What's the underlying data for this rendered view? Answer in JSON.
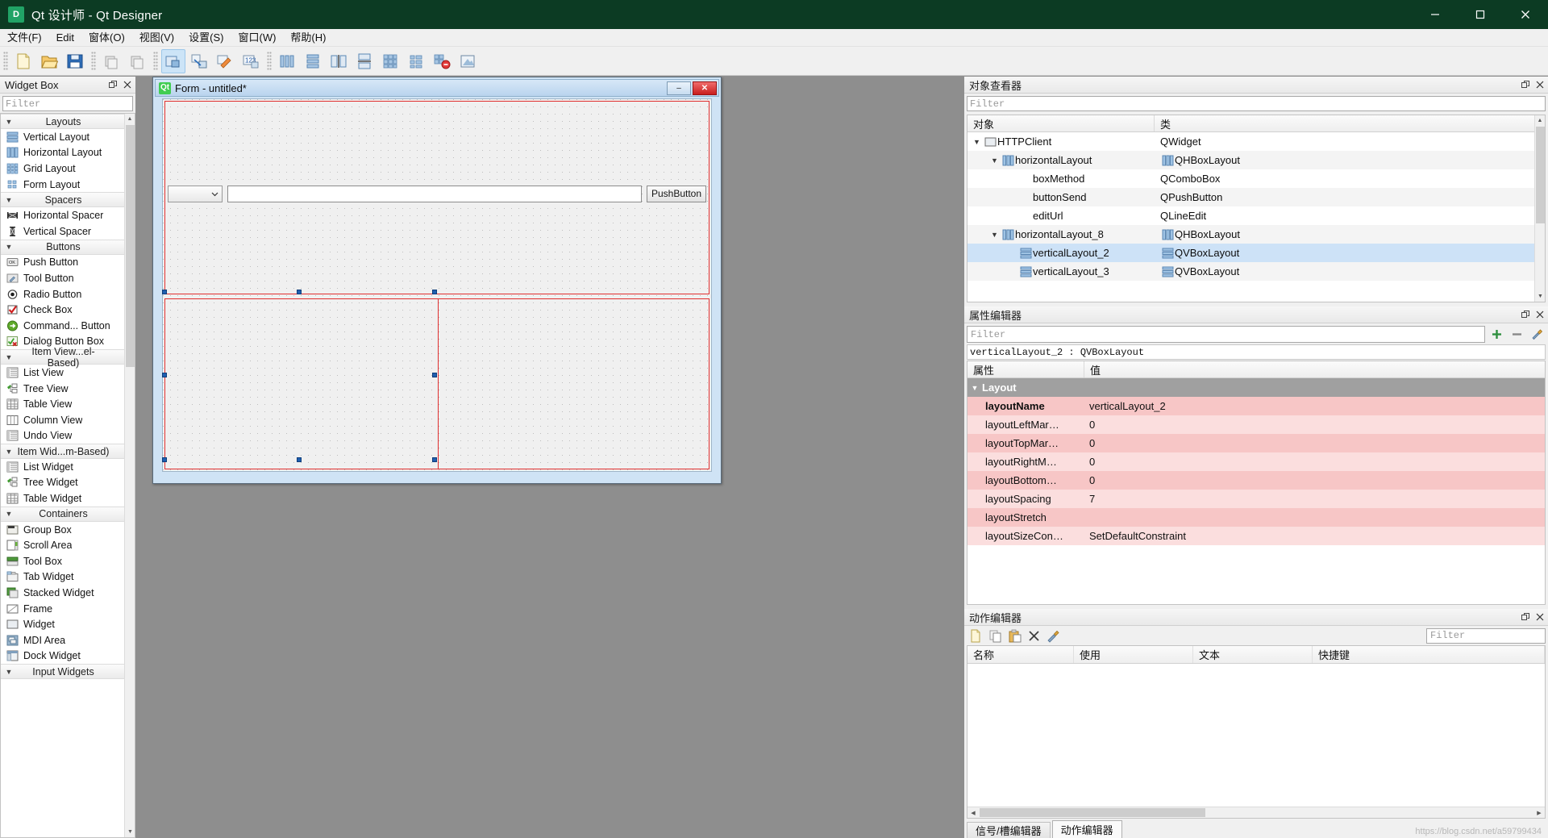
{
  "window": {
    "title": "Qt 设计师 - Qt Designer",
    "app_icon": "D",
    "minimize_label": "minimize",
    "maximize_label": "maximize",
    "close_label": "close"
  },
  "menubar": {
    "items": [
      {
        "label": "文件(F)"
      },
      {
        "label": "Edit"
      },
      {
        "label": "窗体(O)"
      },
      {
        "label": "视图(V)"
      },
      {
        "label": "设置(S)"
      },
      {
        "label": "窗口(W)"
      },
      {
        "label": "帮助(H)"
      }
    ]
  },
  "toolbar": {
    "groups": [
      [
        "new-file-icon",
        "open-file-icon",
        "save-file-icon"
      ],
      [
        "undo-icon",
        "redo-icon"
      ],
      [
        "edit-widgets-icon",
        "edit-signals-icon",
        "edit-buddies-icon",
        "edit-tab-order-icon"
      ],
      [
        "layout-horizontal-icon",
        "layout-vertical-icon",
        "layout-splitter-h-icon",
        "layout-splitter-v-icon",
        "layout-grid-icon",
        "layout-form-icon",
        "break-layout-icon",
        "adjust-size-icon"
      ]
    ]
  },
  "widget_box": {
    "title": "Widget Box",
    "filter_placeholder": "Filter",
    "float_button": "float-icon",
    "close_button": "close-icon",
    "categories": [
      {
        "name": "Layouts",
        "items": [
          {
            "label": "Vertical Layout",
            "icon": "vertical-layout-icon"
          },
          {
            "label": "Horizontal Layout",
            "icon": "horizontal-layout-icon"
          },
          {
            "label": "Grid Layout",
            "icon": "grid-layout-icon"
          },
          {
            "label": "Form Layout",
            "icon": "form-layout-icon"
          }
        ]
      },
      {
        "name": "Spacers",
        "items": [
          {
            "label": "Horizontal Spacer",
            "icon": "horizontal-spacer-icon"
          },
          {
            "label": "Vertical Spacer",
            "icon": "vertical-spacer-icon"
          }
        ]
      },
      {
        "name": "Buttons",
        "items": [
          {
            "label": "Push Button",
            "icon": "push-button-icon"
          },
          {
            "label": "Tool Button",
            "icon": "tool-button-icon"
          },
          {
            "label": "Radio Button",
            "icon": "radio-button-icon"
          },
          {
            "label": "Check Box",
            "icon": "check-box-icon"
          },
          {
            "label": "Command... Button",
            "icon": "command-link-button-icon"
          },
          {
            "label": "Dialog Button Box",
            "icon": "dialog-button-box-icon"
          }
        ]
      },
      {
        "name": "Item View...el-Based)",
        "items": [
          {
            "label": "List View",
            "icon": "list-view-icon"
          },
          {
            "label": "Tree View",
            "icon": "tree-view-icon"
          },
          {
            "label": "Table View",
            "icon": "table-view-icon"
          },
          {
            "label": "Column View",
            "icon": "column-view-icon"
          },
          {
            "label": "Undo View",
            "icon": "undo-view-icon"
          }
        ]
      },
      {
        "name": "Item Wid...m-Based)",
        "items": [
          {
            "label": "List Widget",
            "icon": "list-widget-icon"
          },
          {
            "label": "Tree Widget",
            "icon": "tree-widget-icon"
          },
          {
            "label": "Table Widget",
            "icon": "table-widget-icon"
          }
        ]
      },
      {
        "name": "Containers",
        "items": [
          {
            "label": "Group Box",
            "icon": "group-box-icon"
          },
          {
            "label": "Scroll Area",
            "icon": "scroll-area-icon"
          },
          {
            "label": "Tool Box",
            "icon": "tool-box-icon"
          },
          {
            "label": "Tab Widget",
            "icon": "tab-widget-icon"
          },
          {
            "label": "Stacked Widget",
            "icon": "stacked-widget-icon"
          },
          {
            "label": "Frame",
            "icon": "frame-icon"
          },
          {
            "label": "Widget",
            "icon": "widget-icon"
          },
          {
            "label": "MDI Area",
            "icon": "mdi-area-icon"
          },
          {
            "label": "Dock Widget",
            "icon": "dock-widget-icon"
          }
        ]
      },
      {
        "name": "Input Widgets",
        "items": []
      }
    ]
  },
  "form": {
    "title": "Form - untitled*",
    "logo": "Qt",
    "minimize_label": "–",
    "close_label": "✕",
    "combo_value": "",
    "lineedit_value": "",
    "button_label": "PushButton"
  },
  "object_inspector": {
    "title": "对象查看器",
    "filter_placeholder": "Filter",
    "float_button": "float-icon",
    "close_button": "close-icon",
    "columns": [
      "对象",
      "类"
    ],
    "rows": [
      {
        "name": "HTTPClient",
        "class": "QWidget",
        "indent": 0,
        "expandable": true,
        "icon": "widget-icon",
        "class_icon": "",
        "selected": false
      },
      {
        "name": "horizontalLayout",
        "class": "QHBoxLayout",
        "indent": 1,
        "expandable": true,
        "icon": "horizontal-layout-icon",
        "class_icon": "horizontal-layout-icon",
        "selected": false
      },
      {
        "name": "boxMethod",
        "class": "QComboBox",
        "indent": 2,
        "expandable": false,
        "icon": "",
        "class_icon": "",
        "selected": false
      },
      {
        "name": "buttonSend",
        "class": "QPushButton",
        "indent": 2,
        "expandable": false,
        "icon": "",
        "class_icon": "",
        "selected": false
      },
      {
        "name": "editUrl",
        "class": "QLineEdit",
        "indent": 2,
        "expandable": false,
        "icon": "",
        "class_icon": "",
        "selected": false
      },
      {
        "name": "horizontalLayout_8",
        "class": "QHBoxLayout",
        "indent": 1,
        "expandable": true,
        "icon": "horizontal-layout-icon",
        "class_icon": "horizontal-layout-icon",
        "selected": false
      },
      {
        "name": "verticalLayout_2",
        "class": "QVBoxLayout",
        "indent": 2,
        "expandable": false,
        "icon": "vertical-layout-icon",
        "class_icon": "vertical-layout-icon",
        "selected": true
      },
      {
        "name": "verticalLayout_3",
        "class": "QVBoxLayout",
        "indent": 2,
        "expandable": false,
        "icon": "vertical-layout-icon",
        "class_icon": "vertical-layout-icon",
        "selected": false
      }
    ]
  },
  "property_editor": {
    "title": "属性编辑器",
    "filter_placeholder": "Filter",
    "float_button": "float-icon",
    "close_button": "close-icon",
    "add_button": "add-icon",
    "remove_button": "remove-icon",
    "config_button": "configure-icon",
    "object_line": "verticalLayout_2 : QVBoxLayout",
    "columns": [
      "属性",
      "值"
    ],
    "group": "Layout",
    "rows": [
      {
        "name": "layoutName",
        "value": "verticalLayout_2",
        "bold": true
      },
      {
        "name": "layoutLeftMar…",
        "value": "0",
        "bold": false
      },
      {
        "name": "layoutTopMar…",
        "value": "0",
        "bold": false
      },
      {
        "name": "layoutRightM…",
        "value": "0",
        "bold": false
      },
      {
        "name": "layoutBottom…",
        "value": "0",
        "bold": false
      },
      {
        "name": "layoutSpacing",
        "value": "7",
        "bold": false
      },
      {
        "name": "layoutStretch",
        "value": "",
        "bold": false
      },
      {
        "name": "layoutSizeCon…",
        "value": "SetDefaultConstraint",
        "bold": false
      }
    ]
  },
  "action_editor": {
    "title": "动作编辑器",
    "float_button": "float-icon",
    "close_button": "close-icon",
    "filter_placeholder": "Filter",
    "toolbar_icons": [
      "new-action-icon",
      "copy-action-icon",
      "paste-action-icon",
      "delete-action-icon",
      "edit-action-icon"
    ],
    "columns": [
      "名称",
      "使用",
      "文本",
      "快捷键"
    ],
    "rows": [],
    "tabs": [
      {
        "label": "信号/槽编辑器",
        "active": false
      },
      {
        "label": "动作编辑器",
        "active": true
      }
    ]
  },
  "watermark": "https://blog.csdn.net/a59799434"
}
